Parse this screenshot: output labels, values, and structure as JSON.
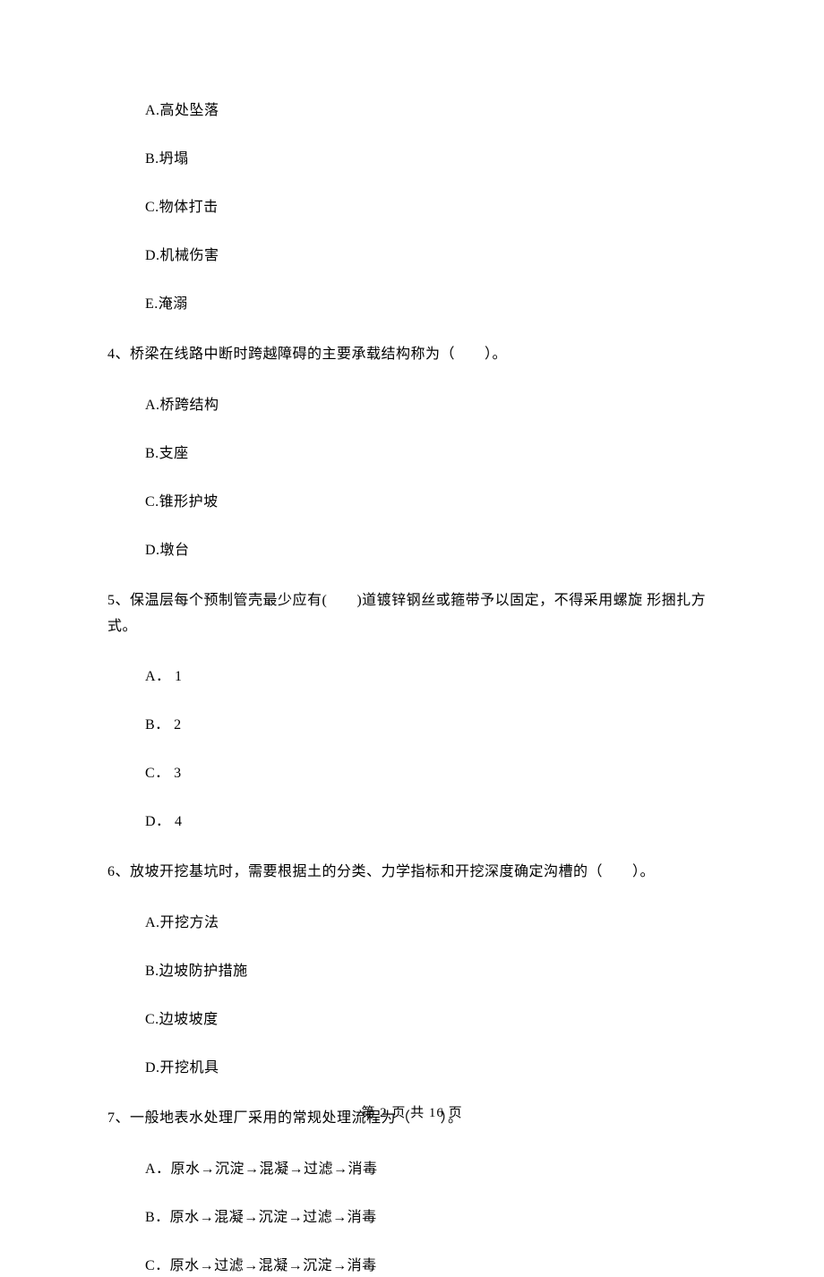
{
  "options_group_1": {
    "a": "A.高处坠落",
    "b": "B.坍塌",
    "c": "C.物体打击",
    "d": "D.机械伤害",
    "e": "E.淹溺"
  },
  "q4": {
    "text": "4、桥梁在线路中断时跨越障碍的主要承载结构称为（　　）。",
    "a": "A.桥跨结构",
    "b": "B.支座",
    "c": "C.锥形护坡",
    "d": "D.墩台"
  },
  "q5": {
    "text": "5、保温层每个预制管壳最少应有(　　)道镀锌钢丝或箍带予以固定，不得采用螺旋 形捆扎方式。",
    "a": "A． 1",
    "b": "B． 2",
    "c": "C． 3",
    "d": "D． 4"
  },
  "q6": {
    "text": "6、放坡开挖基坑时，需要根据土的分类、力学指标和开挖深度确定沟槽的（　　）。",
    "a": "A.开挖方法",
    "b": "B.边坡防护措施",
    "c": "C.边坡坡度",
    "d": "D.开挖机具"
  },
  "q7": {
    "text": "7、一般地表水处理厂采用的常规处理流程为（　　）。",
    "a": "A．原水→沉淀→混凝→过滤→消毒",
    "b": "B．原水→混凝→沉淀→过滤→消毒",
    "c": "C．原水→过滤→混凝→沉淀→消毒"
  },
  "footer": "第 2 页 共 16 页"
}
